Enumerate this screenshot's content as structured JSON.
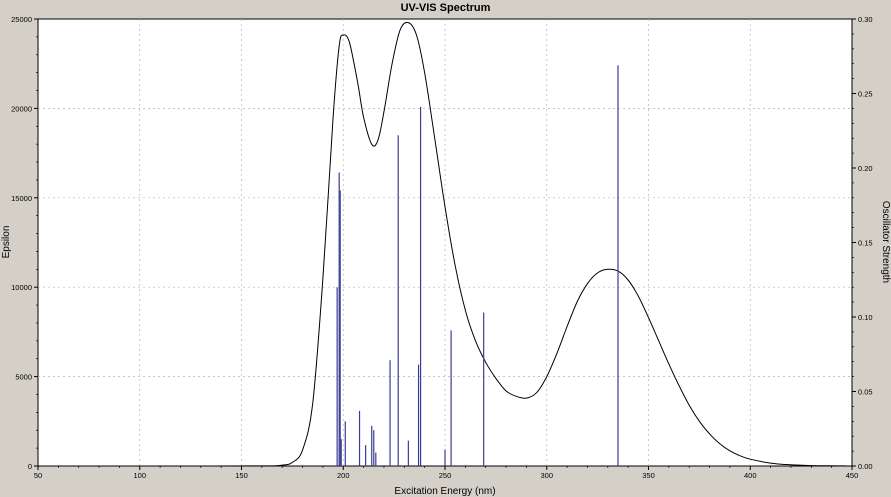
{
  "chart_data": {
    "type": "line",
    "title": "UV-VIS Spectrum",
    "xlabel": "Excitation Energy (nm)",
    "ylabel": "Epsilon",
    "y2label": "Oscillator Strength",
    "xlim": [
      50,
      450
    ],
    "ylim": [
      0,
      25000
    ],
    "y2lim": [
      0,
      0.3
    ],
    "x_ticks": [
      "50",
      "100",
      "150",
      "200",
      "250",
      "300",
      "350",
      "400",
      "450"
    ],
    "y_ticks": [
      "0",
      "5000",
      "10000",
      "15000",
      "20000",
      "25000"
    ],
    "y2_ticks": [
      "0.00",
      "0.05",
      "0.10",
      "0.15",
      "0.20",
      "0.25",
      "0.30"
    ],
    "grid": true,
    "colors": {
      "curve": "#000000",
      "sticks": "#3c3c96",
      "plot_bg": "#ffffff",
      "frame_bg": "#d4d0c8",
      "grid": "#b4b4b4"
    },
    "series": [
      {
        "kind": "curve",
        "x": [
          83,
          120,
          160,
          170,
          175,
          180,
          185,
          190,
          195,
          198,
          200,
          203,
          207,
          210,
          214,
          217,
          220,
          224,
          228,
          232,
          236,
          240,
          245,
          250,
          255,
          260,
          265,
          270,
          275,
          280,
          285,
          290,
          295,
          300,
          305,
          310,
          315,
          320,
          325,
          330,
          335,
          340,
          345,
          350,
          355,
          360,
          365,
          370,
          375,
          380,
          385,
          390,
          395,
          400,
          410,
          420,
          430,
          440,
          447
        ],
        "y": [
          0,
          0,
          5,
          50,
          200,
          900,
          3500,
          10500,
          19500,
          23500,
          24100,
          23700,
          21500,
          19500,
          18000,
          18200,
          19800,
          22500,
          24400,
          24800,
          24100,
          22000,
          18300,
          14500,
          11200,
          8700,
          7000,
          5800,
          4900,
          4200,
          3900,
          3800,
          4100,
          5000,
          6300,
          7800,
          9200,
          10200,
          10800,
          11000,
          10900,
          10400,
          9500,
          8300,
          7000,
          5700,
          4500,
          3400,
          2500,
          1800,
          1250,
          850,
          570,
          380,
          160,
          65,
          25,
          10,
          5
        ]
      },
      {
        "kind": "sticks",
        "x": [
          197,
          198,
          198.5,
          199,
          201,
          208,
          211,
          214,
          215,
          216,
          223,
          227,
          232,
          237,
          238,
          250,
          253,
          269,
          335
        ],
        "y": [
          0.12,
          0.197,
          0.185,
          0.018,
          0.03,
          0.037,
          0.014,
          0.027,
          0.024,
          0.009,
          0.071,
          0.222,
          0.017,
          0.068,
          0.241,
          0.011,
          0.091,
          0.103,
          0.269
        ]
      }
    ]
  }
}
